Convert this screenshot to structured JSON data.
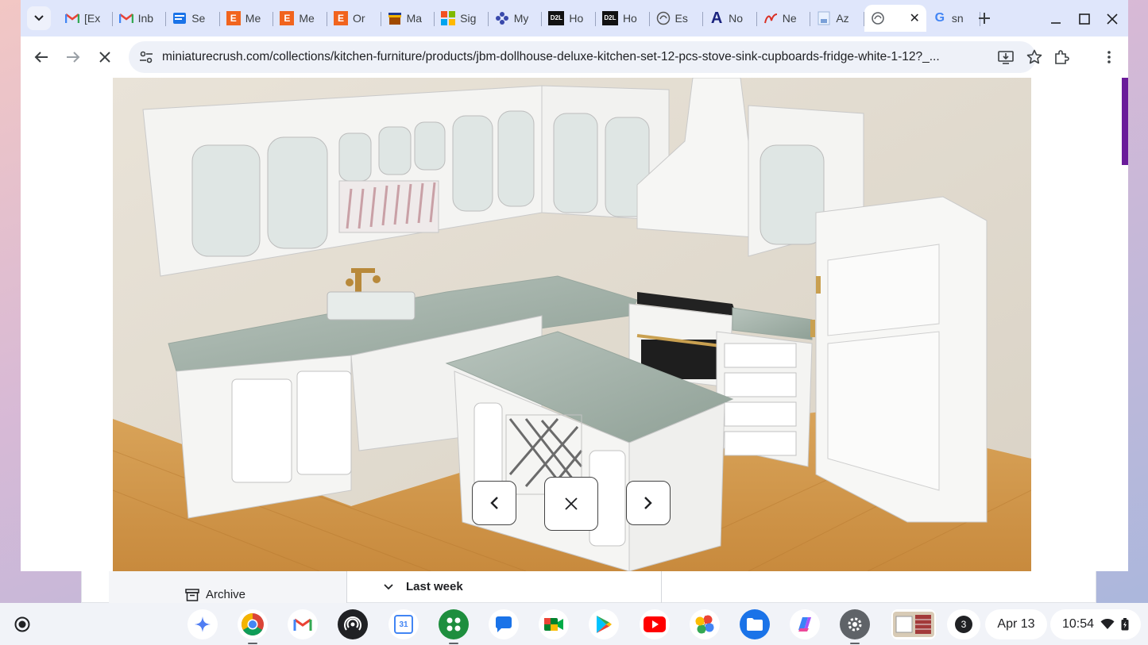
{
  "background_app": {
    "archive_label": "Archive",
    "last_week_label": "Last week"
  },
  "browser": {
    "tabs": [
      {
        "favicon": "gmail-icon",
        "title": "[Ex"
      },
      {
        "favicon": "gmail-icon",
        "title": "Inb"
      },
      {
        "favicon": "docs-icon",
        "title": "Se"
      },
      {
        "favicon": "etsy-icon",
        "title": "Me"
      },
      {
        "favicon": "etsy-icon",
        "title": "Me"
      },
      {
        "favicon": "etsy-icon",
        "title": "Or"
      },
      {
        "favicon": "store-icon",
        "title": "Ma"
      },
      {
        "favicon": "microsoft-icon",
        "title": "Sig"
      },
      {
        "favicon": "pinwheel-icon",
        "title": "My"
      },
      {
        "favicon": "d2l-icon",
        "title": "Ho"
      },
      {
        "favicon": "d2l-icon",
        "title": "Ho"
      },
      {
        "favicon": "circle-logo-icon",
        "title": "Es"
      },
      {
        "favicon": "a-logo-icon",
        "title": "No"
      },
      {
        "favicon": "swoosh-icon",
        "title": "Ne"
      },
      {
        "favicon": "page-icon",
        "title": "Az"
      },
      {
        "favicon": "loading-icon",
        "title": "",
        "active": true
      },
      {
        "favicon": "google-icon",
        "title": "sn"
      }
    ],
    "etsy_letter": "E",
    "d2l_text": "D2L",
    "a_letter": "A",
    "google_letter": "G",
    "url": "miniaturecrush.com/collections/kitchen-furniture/products/jbm-dollhouse-deluxe-kitchen-set-12-pcs-stove-sink-cupboards-fridge-white-1-12?_...",
    "accent_color": "#6a1b9a"
  },
  "shelf": {
    "apps": [
      {
        "name": "gemini-icon",
        "color": "#ffffff"
      },
      {
        "name": "chrome-icon",
        "color": "#ffffff"
      },
      {
        "name": "gmail-icon",
        "color": "#ffffff"
      },
      {
        "name": "podcast-icon",
        "color": "#202124"
      },
      {
        "name": "calendar-icon",
        "color": "#ffffff"
      },
      {
        "name": "apps-grid-icon",
        "color": "#1e8e3e"
      },
      {
        "name": "chat-icon",
        "color": "#ffffff"
      },
      {
        "name": "meet-icon",
        "color": "#ffffff"
      },
      {
        "name": "play-store-icon",
        "color": "#ffffff"
      },
      {
        "name": "youtube-icon",
        "color": "#ffffff"
      },
      {
        "name": "photos-icon",
        "color": "#ffffff"
      },
      {
        "name": "files-icon",
        "color": "#1a73e8"
      },
      {
        "name": "copilot-icon",
        "color": "#ffffff"
      },
      {
        "name": "settings-icon",
        "color": "#5f6368"
      },
      {
        "name": "thumbnail-icon",
        "color": "#ffffff"
      }
    ],
    "calendar_day": "31",
    "notification_count": "3",
    "date": "Apr 13",
    "time": "10:54"
  }
}
